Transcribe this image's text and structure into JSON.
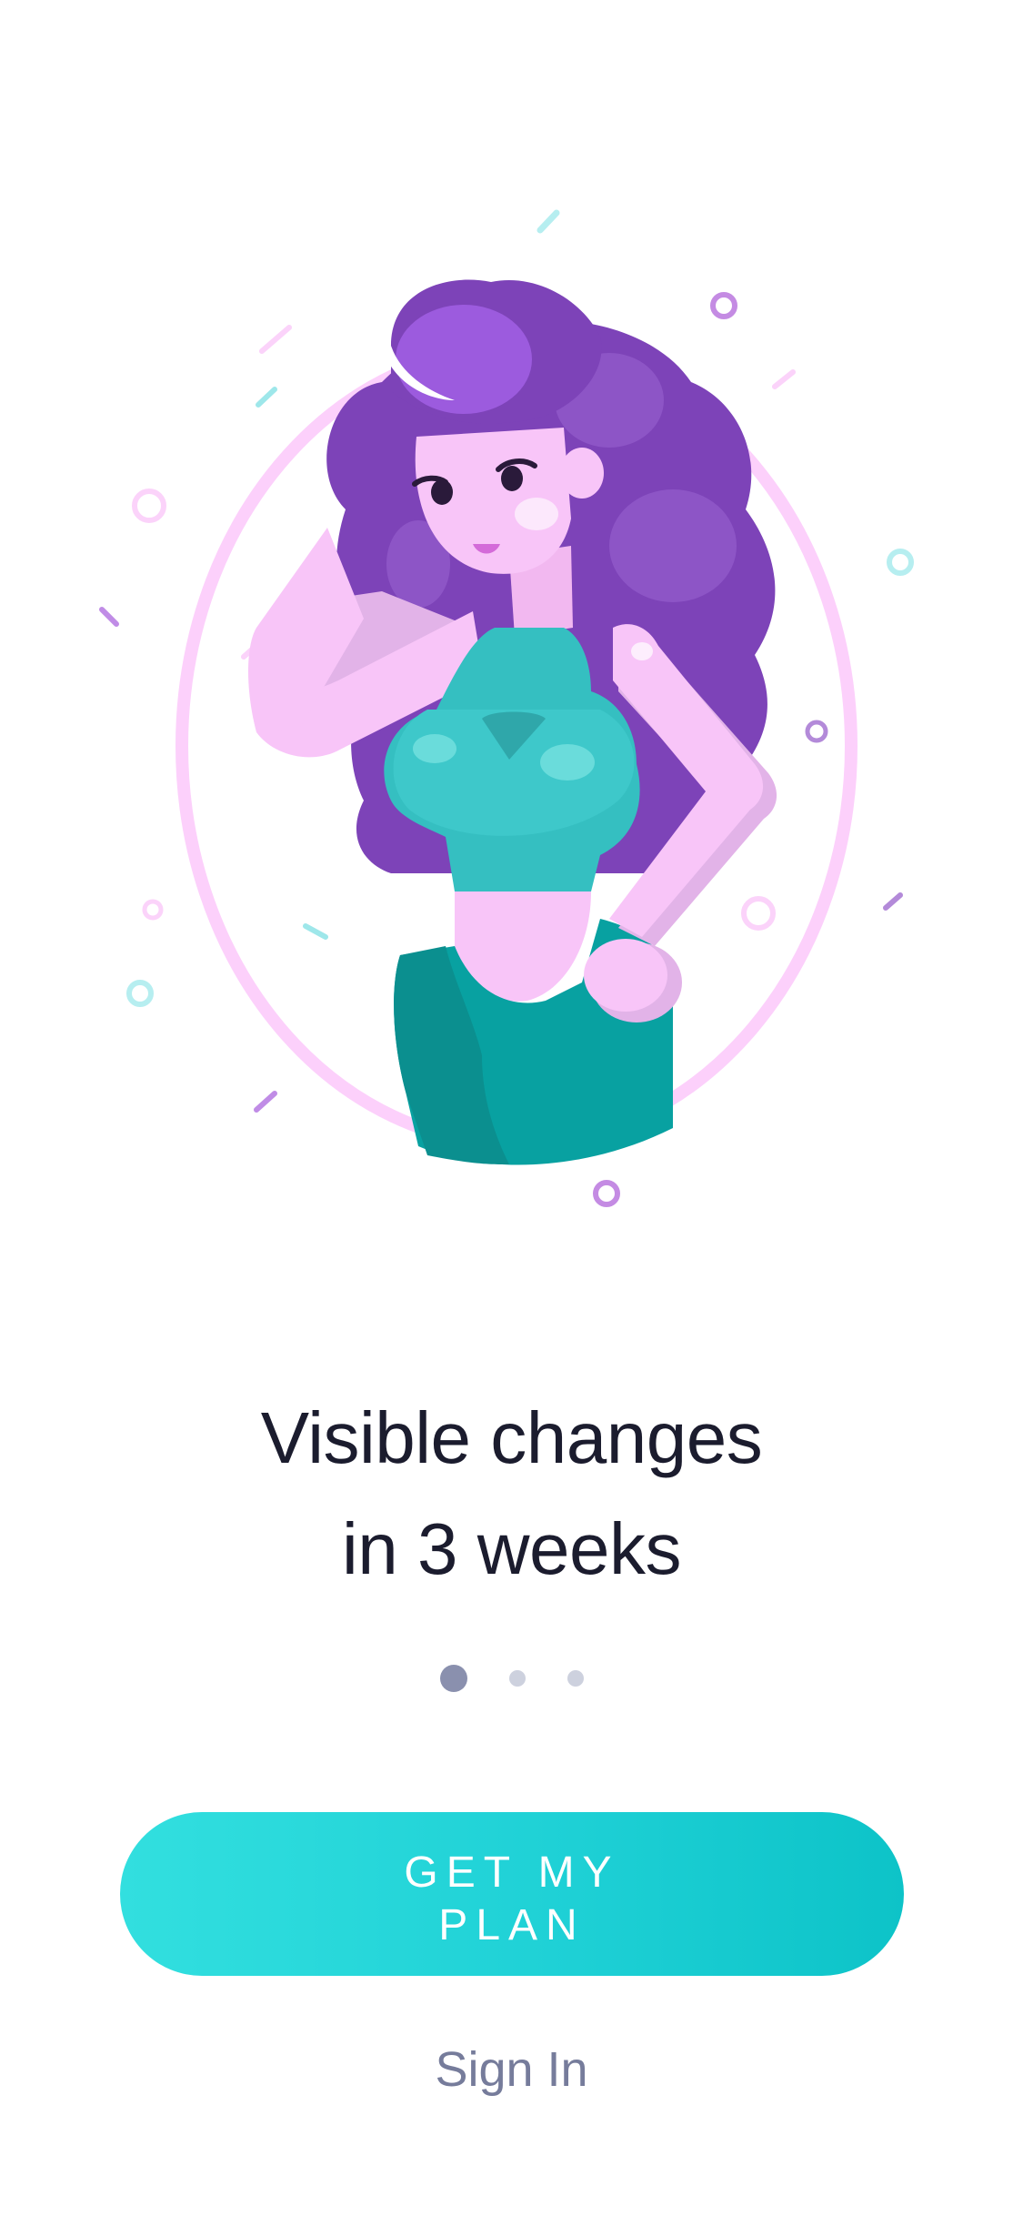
{
  "onboarding": {
    "headline_line1": "Visible changes",
    "headline_line2": "in 3 weeks",
    "pager": {
      "count": 3,
      "active_index": 0
    },
    "cta_label": "GET MY PLAN",
    "signin_label": "Sign In"
  },
  "colors": {
    "accent_start": "#32dfdf",
    "accent_end": "#0dc3c8",
    "headline": "#1b1c2e",
    "secondary_text": "#767c9b",
    "dot_active": "#8a90ae",
    "dot_inactive": "#cdd1de"
  },
  "illustration": {
    "subject": "woman-with-purple-hair-icon",
    "frame": "oval-mirror-frame"
  }
}
